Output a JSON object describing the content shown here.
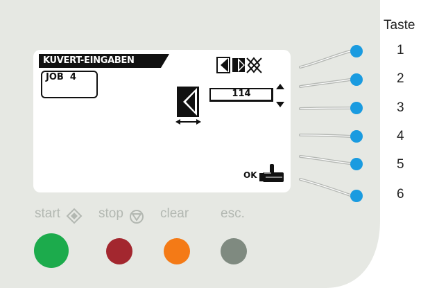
{
  "screen": {
    "header_title": "KUVERT-EINGABEN",
    "job_label": "JOB  4",
    "value": "114",
    "ok_label": "OK"
  },
  "legend": {
    "title": "Taste",
    "numbers": [
      "1",
      "2",
      "3",
      "4",
      "5",
      "6"
    ]
  },
  "buttons": {
    "start": "start",
    "stop": "stop",
    "clear": "clear",
    "esc": "esc."
  },
  "colors": {
    "panel": "#e6e8e3",
    "led": "#1a9be0",
    "start": "#1cab4c",
    "stop": "#a3272f",
    "clear": "#f47a16",
    "esc": "#7f8a80"
  },
  "icons": [
    "envelope-flap-icon",
    "envelope-flap-right-icon",
    "envelope-crossed-icon",
    "arrow-up-icon",
    "arrow-down-icon",
    "envelope-width-icon",
    "hand-ok-icon",
    "start-diamond-icon",
    "stop-circle-icon"
  ]
}
